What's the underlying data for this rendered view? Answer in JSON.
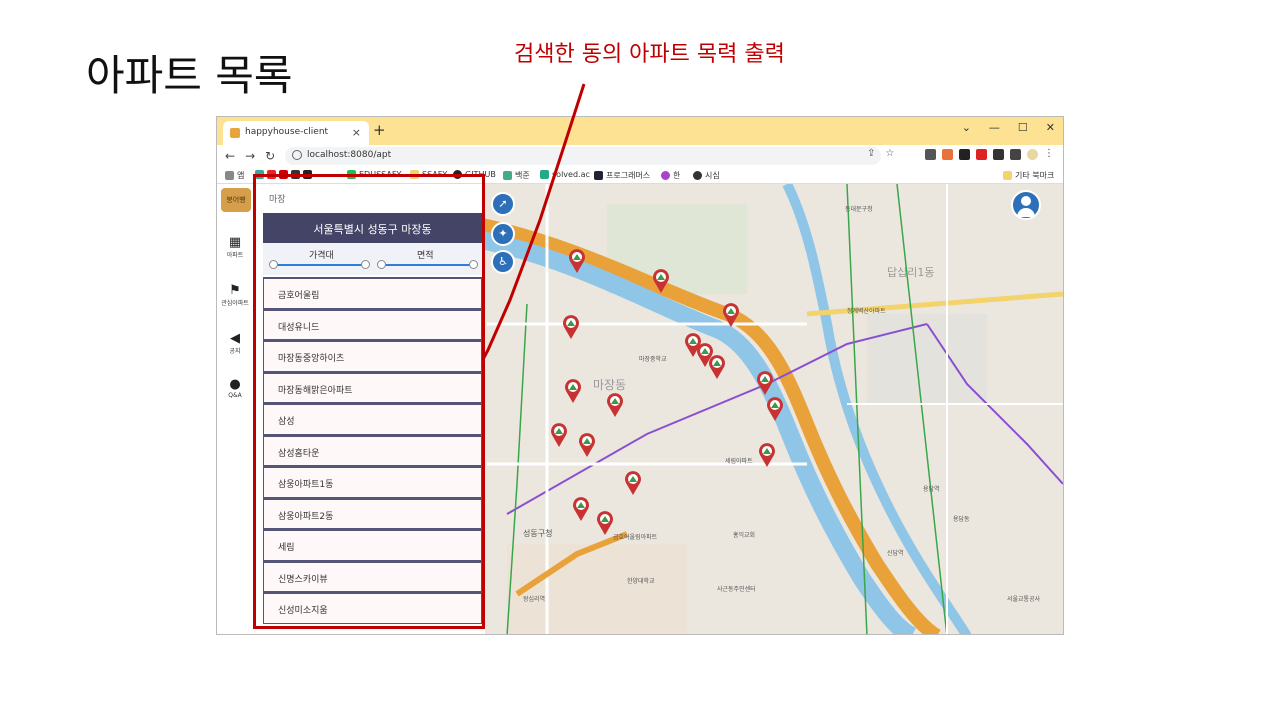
{
  "slide": {
    "title": "아파트 목록",
    "annotation": "검색한 동의 아파트 목력 출력"
  },
  "browser": {
    "tab_title": "happyhouse-client",
    "url": "localhost:8080/apt",
    "bookmarks": [
      "앱",
      "EDUSSAFY",
      "SSAFY",
      "GITHUB",
      "백준",
      "solved.ac",
      "프로그래머스",
      "한",
      "시심",
      "기타 북마크"
    ]
  },
  "sidebar": {
    "logo_text": "붕어빵",
    "items": [
      {
        "label": "아파트",
        "icon": "building-icon"
      },
      {
        "label": "관심아파트",
        "icon": "flag-icon"
      },
      {
        "label": "공지",
        "icon": "megaphone-icon"
      },
      {
        "label": "Q&A",
        "icon": "qa-icon"
      }
    ]
  },
  "panel": {
    "search_value": "마장",
    "region": "서울특별시 성동구 마장동",
    "filters": {
      "price_label": "가격대",
      "area_label": "면적"
    },
    "apartments": [
      "금호어울림",
      "대성유니드",
      "마장동중앙하이츠",
      "마장동해맑은아파트",
      "삼성",
      "삼성홈타운",
      "삼웅아파트1동",
      "삼웅아파트2동",
      "세림",
      "신명스카이뷰",
      "신성미소지움"
    ]
  },
  "map": {
    "labels": [
      "마장동",
      "성동구청",
      "답십리1동",
      "한양대학교",
      "서울교통공사",
      "용답동",
      "청계벽산아파트",
      "마장중학교",
      "세림아파트",
      "금호어울림아파트",
      "홍익교회",
      "사근동주민센터",
      "신답역",
      "용답역",
      "왕십리역",
      "동대문구청"
    ]
  },
  "colors": {
    "annotation": "#c00000",
    "header": "#444466",
    "marker": "#c83232",
    "accent": "#2d6fb8"
  }
}
